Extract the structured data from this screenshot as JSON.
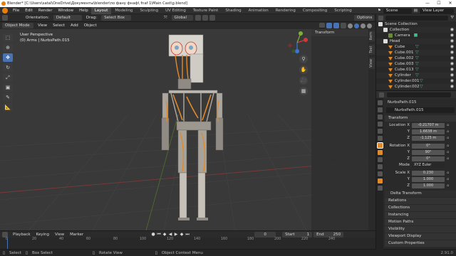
{
  "titlebar": {
    "title": "Blender* [C:\\Users\\satal\\OneDrive\\Документы\\blender\\по фану фнаф\\ fnaf 1\\Main Cast\\g.blend]"
  },
  "menubar": {
    "menus": [
      "File",
      "Edit",
      "Render",
      "Window",
      "Help"
    ],
    "workspaces": [
      "Layout",
      "Modeling",
      "Sculpting",
      "UV Editing",
      "Texture Paint",
      "Shading",
      "Animation",
      "Rendering",
      "Compositing",
      "Scripting"
    ],
    "scene": "Scene",
    "view_layer": "View Layer"
  },
  "viewport_header": {
    "orientation_label": "Orientation:",
    "orientation_value": "Default",
    "drag_label": "Drag:",
    "drag_value": "Select Box",
    "transform_space": "Global",
    "options": "Options"
  },
  "viewport_header2": {
    "mode": "Object Mode",
    "menus": [
      "View",
      "Select",
      "Add",
      "Object"
    ]
  },
  "viewport": {
    "perspective": "User Perspective",
    "collection_info": "(0) Arms | NurbsPath.015",
    "n_panel_title": "Transform",
    "side_tabs": [
      "Item",
      "Tool",
      "View"
    ]
  },
  "outliner": {
    "items": [
      {
        "name": "Scene Collection",
        "icon": "scene-collection-icon",
        "indent": 0
      },
      {
        "name": "Collection",
        "icon": "collection-icon",
        "indent": 1
      },
      {
        "name": "Camera",
        "icon": "camera-icon",
        "indent": 2
      },
      {
        "name": "Head",
        "icon": "collection-icon",
        "indent": 1
      },
      {
        "name": "Cube",
        "icon": "mesh-icon",
        "indent": 2,
        "mod": true
      },
      {
        "name": "Cube.001",
        "icon": "mesh-icon",
        "indent": 2,
        "mod": true
      },
      {
        "name": "Cube.002",
        "icon": "mesh-icon",
        "indent": 2,
        "mod": true
      },
      {
        "name": "Cube.003",
        "icon": "mesh-icon",
        "indent": 2,
        "mod": true
      },
      {
        "name": "Cube.013",
        "icon": "mesh-icon",
        "indent": 2,
        "mod": true
      },
      {
        "name": "Cylinder",
        "icon": "mesh-icon",
        "indent": 2,
        "mod": true
      },
      {
        "name": "Cylinder.001",
        "icon": "mesh-icon",
        "indent": 2,
        "mod": true
      },
      {
        "name": "Cylinder.002",
        "icon": "mesh-icon",
        "indent": 2,
        "mod": true
      }
    ]
  },
  "properties": {
    "object_name_title": "NurbsPath.015",
    "object_name_field": "NurbsPath.015",
    "transform_title": "Transform",
    "location": {
      "label": "Location X",
      "x": "-0.21707 m",
      "y": "1.6638 m",
      "z": "-1.125 m"
    },
    "rotation": {
      "label": "Rotation X",
      "x": "0°",
      "y": "90°",
      "z": "0°"
    },
    "mode_label": "Mode",
    "mode_value": "XYZ Euler",
    "scale": {
      "label": "Scale X",
      "x": "0.230",
      "y": "1.000",
      "z": "1.000"
    },
    "delta_transform": "Delta Transform",
    "sections": [
      "Relations",
      "Collections",
      "Instancing",
      "Motion Paths",
      "Visibility",
      "Viewport Display",
      "Custom Properties"
    ]
  },
  "timeline": {
    "menus": [
      "Playback",
      "Keying",
      "View",
      "Marker"
    ],
    "current_frame": "0",
    "start_label": "Start",
    "start_value": "1",
    "end_label": "End",
    "end_value": "250",
    "ruler": [
      "0",
      "20",
      "40",
      "60",
      "80",
      "100",
      "120",
      "140",
      "160",
      "180",
      "200",
      "220",
      "240"
    ]
  },
  "statusbar": {
    "items": [
      "Select",
      "Box Select",
      "Rotate View",
      "Object Context Menu"
    ],
    "version": "2.91.0"
  }
}
